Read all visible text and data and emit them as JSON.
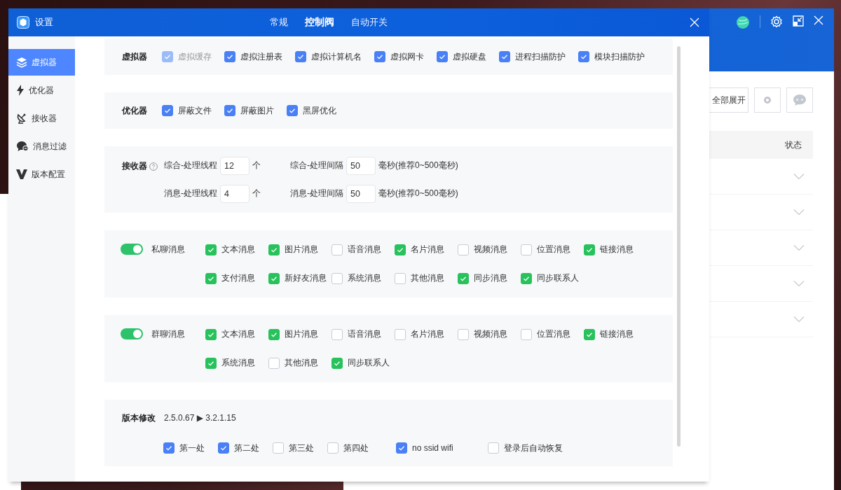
{
  "window": {
    "title": "设置"
  },
  "tabs": [
    {
      "label": "常规",
      "selected": false
    },
    {
      "label": "控制阀",
      "selected": true
    },
    {
      "label": "自动开关",
      "selected": false
    }
  ],
  "sidebar": {
    "items": [
      {
        "label": "虚拟器",
        "selected": true
      },
      {
        "label": "优化器",
        "selected": false
      },
      {
        "label": "接收器",
        "selected": false
      },
      {
        "label": "消息过滤",
        "selected": false
      },
      {
        "label": "版本配置",
        "selected": false
      }
    ]
  },
  "sections": [
    {
      "kind": "checks",
      "label": "虚拟器",
      "options": [
        {
          "label": "虚拟缓存",
          "checked": true,
          "disabled": true
        },
        {
          "label": "虚拟注册表",
          "checked": true,
          "disabled": false
        },
        {
          "label": "虚拟计算机名",
          "checked": true,
          "disabled": false
        },
        {
          "label": "虚拟网卡",
          "checked": true,
          "disabled": false
        },
        {
          "label": "虚拟硬盘",
          "checked": true,
          "disabled": false
        },
        {
          "label": "进程扫描防护",
          "checked": true,
          "disabled": false
        },
        {
          "label": "模块扫描防护",
          "checked": true,
          "disabled": false
        }
      ]
    },
    {
      "kind": "checks",
      "label": "优化器",
      "options": [
        {
          "label": "屏蔽文件",
          "checked": true,
          "disabled": false
        },
        {
          "label": "屏蔽图片",
          "checked": true,
          "disabled": false
        },
        {
          "label": "黑屏优化",
          "checked": true,
          "disabled": false
        }
      ]
    },
    {
      "kind": "receiver",
      "label": "接收器",
      "rows": [
        [
          {
            "label": "综合-处理线程",
            "value": "12",
            "unit": "个"
          },
          {
            "label": "综合-处理间隔",
            "value": "50",
            "unit": "毫秒(推荐0~500毫秒)"
          }
        ],
        [
          {
            "label": "消息-处理线程",
            "value": "4",
            "unit": "个"
          },
          {
            "label": "消息-处理间隔",
            "value": "50",
            "unit": "毫秒(推荐0~500毫秒)"
          }
        ]
      ]
    },
    {
      "kind": "messages",
      "label": "私聊消息",
      "on": true,
      "options": [
        {
          "label": "文本消息",
          "checked": true
        },
        {
          "label": "图片消息",
          "checked": true
        },
        {
          "label": "语音消息",
          "checked": false
        },
        {
          "label": "名片消息",
          "checked": true
        },
        {
          "label": "视频消息",
          "checked": false
        },
        {
          "label": "位置消息",
          "checked": false
        },
        {
          "label": "链接消息",
          "checked": true
        },
        {
          "label": "支付消息",
          "checked": true
        },
        {
          "label": "新好友消息",
          "checked": true
        },
        {
          "label": "系统消息",
          "checked": false
        },
        {
          "label": "其他消息",
          "checked": false
        },
        {
          "label": "同步消息",
          "checked": true
        },
        {
          "label": "同步联系人",
          "checked": true
        }
      ]
    },
    {
      "kind": "messages",
      "label": "群聊消息",
      "on": true,
      "options": [
        {
          "label": "文本消息",
          "checked": true
        },
        {
          "label": "图片消息",
          "checked": true
        },
        {
          "label": "语音消息",
          "checked": false
        },
        {
          "label": "名片消息",
          "checked": false
        },
        {
          "label": "视频消息",
          "checked": false
        },
        {
          "label": "位置消息",
          "checked": false
        },
        {
          "label": "链接消息",
          "checked": true
        },
        {
          "label": "系统消息",
          "checked": true
        },
        {
          "label": "其他消息",
          "checked": false
        },
        {
          "label": "同步联系人",
          "checked": true
        }
      ]
    },
    {
      "kind": "version",
      "label": "版本修改",
      "version": "2.5.0.67 ▶ 3.2.1.15",
      "options": [
        {
          "label": "第一处",
          "checked": true
        },
        {
          "label": "第二处",
          "checked": true
        },
        {
          "label": "第三处",
          "checked": false
        },
        {
          "label": "第四处",
          "checked": false
        },
        {
          "label": "no ssid wifi",
          "checked": true
        },
        {
          "label": "登录后自动恢复",
          "checked": false
        }
      ]
    }
  ],
  "background_window": {
    "expand_button": "全部展开",
    "table": {
      "status_column": "状态",
      "rows": [
        {
          "expanded": false
        },
        {
          "expanded": false
        },
        {
          "expanded": false
        },
        {
          "expanded": false
        },
        {
          "expanded": false
        }
      ]
    }
  }
}
